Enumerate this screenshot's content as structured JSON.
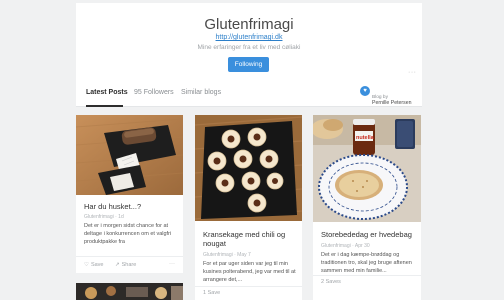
{
  "blog": {
    "title": "Glutenfrimagi",
    "url": "http://glutenfrimagi.dk",
    "description": "Mine erfaringer fra et liv med cøliaki",
    "follow_label": "Following",
    "more_label": "···"
  },
  "tabs": [
    {
      "label": "Latest Posts",
      "active": true
    },
    {
      "label": "95 Followers",
      "active": false
    },
    {
      "label": "Similar blogs",
      "active": false
    }
  ],
  "blog_by": {
    "label": "Blog by",
    "author": "Pernille Petersen"
  },
  "posts": [
    {
      "title": "Har du husket...?",
      "meta": "Glutenfrimagi · 1d",
      "text": "Det er i morgen sidst chance for at deltage i konkurrencen om et valgfri produktpakke fra",
      "save": "Save",
      "share": "Share",
      "more": "···"
    },
    {
      "title": "Kransekage med chili og nougat",
      "meta": "Glutenfrimagi · May 7",
      "text": "For et par uger siden var jeg til min kusines polterabend, jeg var med til at arrangere det,...",
      "save": "1 Save"
    },
    {
      "title": "Storebededag er hvedebag",
      "meta": "Glutenfrimagi · Apr 30",
      "text": "Det er i dag kæmpe-brøddag og traditionen tro, skal jeg bruge aftenen sammen med min familie...",
      "save": "2 Saves"
    }
  ],
  "image_labels": {
    "nutella": "nutella"
  }
}
